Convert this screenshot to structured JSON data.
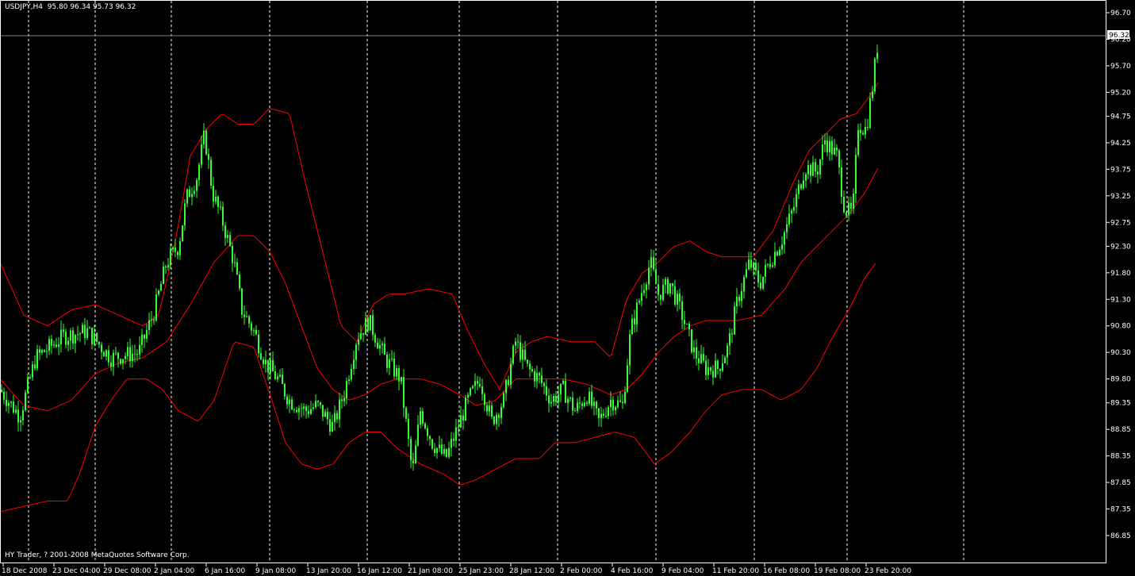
{
  "header": {
    "symbol_info": "USDJPY,H4  95.80 96.34 95.73 96.32"
  },
  "footer": {
    "copyright": "HY Trader, ? 2001-2008 MetaQuotes Software Corp."
  },
  "colors": {
    "background": "#000000",
    "candles": "#33ff33",
    "bands": "#ff0000",
    "grid": "#ffffff",
    "frame": "#ffffff",
    "price_marker_bg": "#ffffff",
    "price_marker_text": "#000000"
  },
  "chart_data": {
    "type": "candlestick",
    "price_axis_ticks": [
      "96.70",
      "96.20",
      "95.70",
      "95.20",
      "94.75",
      "94.25",
      "93.75",
      "93.25",
      "92.75",
      "92.30",
      "91.80",
      "91.30",
      "90.80",
      "90.30",
      "89.80",
      "89.35",
      "88.85",
      "88.35",
      "87.85",
      "87.35",
      "86.85"
    ],
    "ylim": [
      86.85,
      96.7
    ],
    "time_axis_labels": [
      "18 Dec 2008",
      "23 Dec 04:00",
      "29 Dec 08:00",
      "2 Jan 04:00",
      "6 Jan 16:00",
      "9 Jan 08:00",
      "13 Jan 20:00",
      "16 Jan 12:00",
      "21 Jan 08:00",
      "25 Jan 23:00",
      "28 Jan 12:00",
      "2 Feb 00:00",
      "4 Feb 16:00",
      "9 Feb 04:00",
      "11 Feb 20:00",
      "16 Feb 08:00",
      "19 Feb 08:00",
      "23 Feb 20:00"
    ],
    "current_price": 96.32,
    "vertical_grid": "dashed",
    "indicator": "Bollinger Bands",
    "price_path_keypoints": [
      [
        0,
        89.6
      ],
      [
        25,
        89.1
      ],
      [
        45,
        90.2
      ],
      [
        80,
        90.6
      ],
      [
        110,
        90.7
      ],
      [
        140,
        90.2
      ],
      [
        175,
        90.3
      ],
      [
        195,
        91.1
      ],
      [
        210,
        92.0
      ],
      [
        225,
        92.3
      ],
      [
        235,
        93.2
      ],
      [
        248,
        93.6
      ],
      [
        258,
        94.4
      ],
      [
        268,
        93.3
      ],
      [
        280,
        92.8
      ],
      [
        295,
        92.0
      ],
      [
        305,
        91.1
      ],
      [
        320,
        90.7
      ],
      [
        335,
        90.1
      ],
      [
        350,
        89.8
      ],
      [
        365,
        89.4
      ],
      [
        385,
        89.2
      ],
      [
        400,
        89.3
      ],
      [
        420,
        88.9
      ],
      [
        435,
        89.6
      ],
      [
        450,
        90.6
      ],
      [
        465,
        90.9
      ],
      [
        485,
        90.2
      ],
      [
        505,
        89.8
      ],
      [
        520,
        88.0
      ],
      [
        530,
        89.2
      ],
      [
        545,
        88.6
      ],
      [
        562,
        88.3
      ],
      [
        575,
        88.8
      ],
      [
        590,
        89.4
      ],
      [
        605,
        89.8
      ],
      [
        620,
        89.0
      ],
      [
        635,
        89.4
      ],
      [
        650,
        90.5
      ],
      [
        665,
        90.0
      ],
      [
        680,
        89.8
      ],
      [
        695,
        89.4
      ],
      [
        710,
        89.6
      ],
      [
        725,
        89.2
      ],
      [
        740,
        89.5
      ],
      [
        755,
        89.0
      ],
      [
        770,
        89.4
      ],
      [
        785,
        89.3
      ],
      [
        795,
        90.7
      ],
      [
        810,
        91.5
      ],
      [
        820,
        92.0
      ],
      [
        830,
        91.4
      ],
      [
        845,
        91.6
      ],
      [
        860,
        91.0
      ],
      [
        875,
        90.3
      ],
      [
        890,
        90.0
      ],
      [
        905,
        90.0
      ],
      [
        918,
        90.4
      ],
      [
        930,
        91.3
      ],
      [
        945,
        92.0
      ],
      [
        958,
        91.6
      ],
      [
        970,
        92.0
      ],
      [
        985,
        92.4
      ],
      [
        1000,
        93.0
      ],
      [
        1015,
        93.8
      ],
      [
        1030,
        93.7
      ],
      [
        1040,
        94.3
      ],
      [
        1055,
        94.0
      ],
      [
        1065,
        93.0
      ],
      [
        1075,
        92.9
      ],
      [
        1082,
        94.6
      ],
      [
        1092,
        94.5
      ],
      [
        1100,
        95.3
      ],
      [
        1108,
        96.32
      ]
    ],
    "upper_band_keypoints": [
      [
        0,
        92.0
      ],
      [
        30,
        91.0
      ],
      [
        60,
        90.8
      ],
      [
        90,
        91.1
      ],
      [
        120,
        91.2
      ],
      [
        150,
        91.0
      ],
      [
        180,
        90.8
      ],
      [
        200,
        91.0
      ],
      [
        220,
        92.3
      ],
      [
        240,
        94.0
      ],
      [
        260,
        94.5
      ],
      [
        280,
        94.8
      ],
      [
        300,
        94.6
      ],
      [
        320,
        94.6
      ],
      [
        340,
        94.9
      ],
      [
        365,
        94.8
      ],
      [
        385,
        93.5
      ],
      [
        405,
        92.3
      ],
      [
        430,
        90.8
      ],
      [
        450,
        90.5
      ],
      [
        470,
        91.2
      ],
      [
        490,
        91.4
      ],
      [
        510,
        91.4
      ],
      [
        540,
        91.5
      ],
      [
        570,
        91.4
      ],
      [
        590,
        90.7
      ],
      [
        610,
        90.1
      ],
      [
        630,
        89.6
      ],
      [
        650,
        90.3
      ],
      [
        670,
        90.5
      ],
      [
        690,
        90.6
      ],
      [
        720,
        90.5
      ],
      [
        750,
        90.5
      ],
      [
        770,
        90.2
      ],
      [
        790,
        91.3
      ],
      [
        810,
        91.8
      ],
      [
        830,
        92.0
      ],
      [
        850,
        92.3
      ],
      [
        870,
        92.4
      ],
      [
        890,
        92.2
      ],
      [
        910,
        92.1
      ],
      [
        930,
        92.1
      ],
      [
        950,
        92.1
      ],
      [
        975,
        92.6
      ],
      [
        1000,
        93.5
      ],
      [
        1020,
        94.1
      ],
      [
        1040,
        94.4
      ],
      [
        1060,
        94.7
      ],
      [
        1080,
        94.8
      ],
      [
        1095,
        95.1
      ],
      [
        1108,
        95.4
      ]
    ],
    "middle_band_keypoints": [
      [
        0,
        89.8
      ],
      [
        30,
        89.3
      ],
      [
        60,
        89.2
      ],
      [
        90,
        89.4
      ],
      [
        120,
        89.9
      ],
      [
        150,
        90.1
      ],
      [
        180,
        90.2
      ],
      [
        210,
        90.5
      ],
      [
        240,
        91.2
      ],
      [
        270,
        92.0
      ],
      [
        300,
        92.5
      ],
      [
        320,
        92.5
      ],
      [
        340,
        92.2
      ],
      [
        360,
        91.6
      ],
      [
        380,
        90.8
      ],
      [
        400,
        90.0
      ],
      [
        420,
        89.6
      ],
      [
        440,
        89.4
      ],
      [
        460,
        89.5
      ],
      [
        480,
        89.7
      ],
      [
        500,
        89.8
      ],
      [
        530,
        89.8
      ],
      [
        555,
        89.7
      ],
      [
        580,
        89.5
      ],
      [
        600,
        89.3
      ],
      [
        625,
        89.4
      ],
      [
        650,
        89.8
      ],
      [
        680,
        89.8
      ],
      [
        710,
        89.8
      ],
      [
        740,
        89.7
      ],
      [
        770,
        89.5
      ],
      [
        790,
        89.6
      ],
      [
        810,
        89.9
      ],
      [
        830,
        90.3
      ],
      [
        850,
        90.6
      ],
      [
        870,
        90.8
      ],
      [
        890,
        90.9
      ],
      [
        910,
        90.9
      ],
      [
        930,
        90.9
      ],
      [
        960,
        91.0
      ],
      [
        990,
        91.5
      ],
      [
        1010,
        92.0
      ],
      [
        1030,
        92.3
      ],
      [
        1050,
        92.6
      ],
      [
        1070,
        92.9
      ],
      [
        1090,
        93.3
      ],
      [
        1108,
        93.8
      ]
    ],
    "lower_band_keypoints": [
      [
        0,
        87.3
      ],
      [
        30,
        87.4
      ],
      [
        60,
        87.5
      ],
      [
        85,
        87.5
      ],
      [
        100,
        88.0
      ],
      [
        120,
        88.9
      ],
      [
        140,
        89.4
      ],
      [
        160,
        89.8
      ],
      [
        185,
        89.8
      ],
      [
        205,
        89.6
      ],
      [
        225,
        89.2
      ],
      [
        250,
        89.0
      ],
      [
        270,
        89.4
      ],
      [
        295,
        90.5
      ],
      [
        320,
        90.4
      ],
      [
        345,
        89.3
      ],
      [
        360,
        88.6
      ],
      [
        380,
        88.2
      ],
      [
        400,
        88.1
      ],
      [
        420,
        88.2
      ],
      [
        440,
        88.6
      ],
      [
        460,
        88.8
      ],
      [
        480,
        88.8
      ],
      [
        500,
        88.5
      ],
      [
        530,
        88.2
      ],
      [
        560,
        88.0
      ],
      [
        580,
        87.8
      ],
      [
        600,
        87.9
      ],
      [
        625,
        88.1
      ],
      [
        650,
        88.3
      ],
      [
        680,
        88.3
      ],
      [
        700,
        88.6
      ],
      [
        725,
        88.6
      ],
      [
        750,
        88.7
      ],
      [
        775,
        88.8
      ],
      [
        800,
        88.7
      ],
      [
        825,
        88.2
      ],
      [
        845,
        88.4
      ],
      [
        870,
        88.8
      ],
      [
        890,
        89.2
      ],
      [
        910,
        89.5
      ],
      [
        935,
        89.6
      ],
      [
        960,
        89.6
      ],
      [
        985,
        89.4
      ],
      [
        1010,
        89.6
      ],
      [
        1030,
        90.0
      ],
      [
        1050,
        90.6
      ],
      [
        1070,
        91.1
      ],
      [
        1090,
        91.7
      ],
      [
        1105,
        92.0
      ]
    ]
  }
}
